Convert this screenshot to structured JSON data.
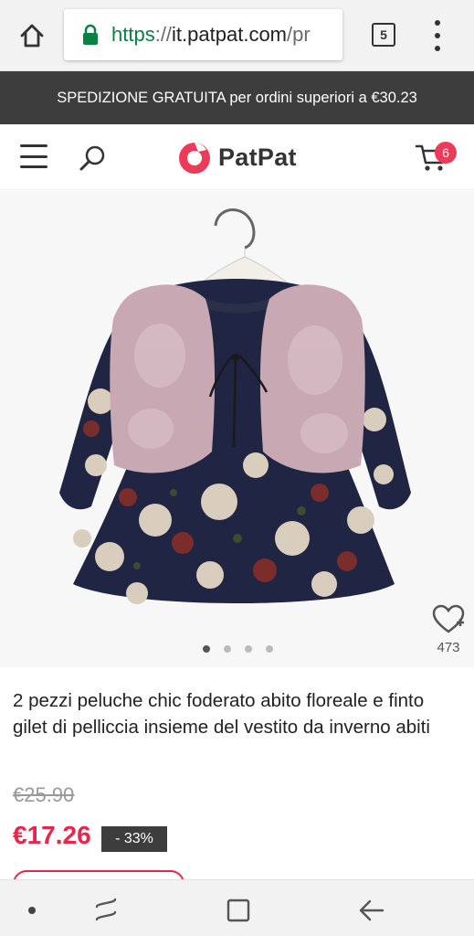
{
  "browser": {
    "url_scheme": "https",
    "url_separator": "://",
    "url_host": "it.patpat.com",
    "url_rest": "/pr",
    "tab_count": "5",
    "icons": {
      "home": "home-icon",
      "lock": "lock-icon",
      "menu": "more-vert-icon"
    }
  },
  "promo": {
    "text": "SPEDIZIONE GRATUITA per ordini superiori a €30.23"
  },
  "header": {
    "logo_text": "PatPat",
    "cart_count": "6",
    "icons": {
      "menu": "hamburger-icon",
      "search": "search-icon",
      "cart": "cart-icon",
      "logo": "patpat-logo-icon"
    }
  },
  "gallery": {
    "image_count": 4,
    "active_index": 0,
    "wishlist_count": "473",
    "icons": {
      "wishlist": "heart-plus-icon"
    }
  },
  "product": {
    "title": "2 pezzi peluche chic foderato abito floreale e finto gilet di pelliccia insieme del vestito da inverno abiti",
    "old_price": "€25.90",
    "new_price": "€17.26",
    "discount": "- 33%"
  },
  "colors": {
    "accent": "#e8264b",
    "banner": "#3d3d3d",
    "url_secure": "#0b8043"
  },
  "nav_bar": {
    "icons": [
      "dot-icon",
      "recent-apps-icon",
      "home-square-icon",
      "back-arrow-icon"
    ]
  }
}
